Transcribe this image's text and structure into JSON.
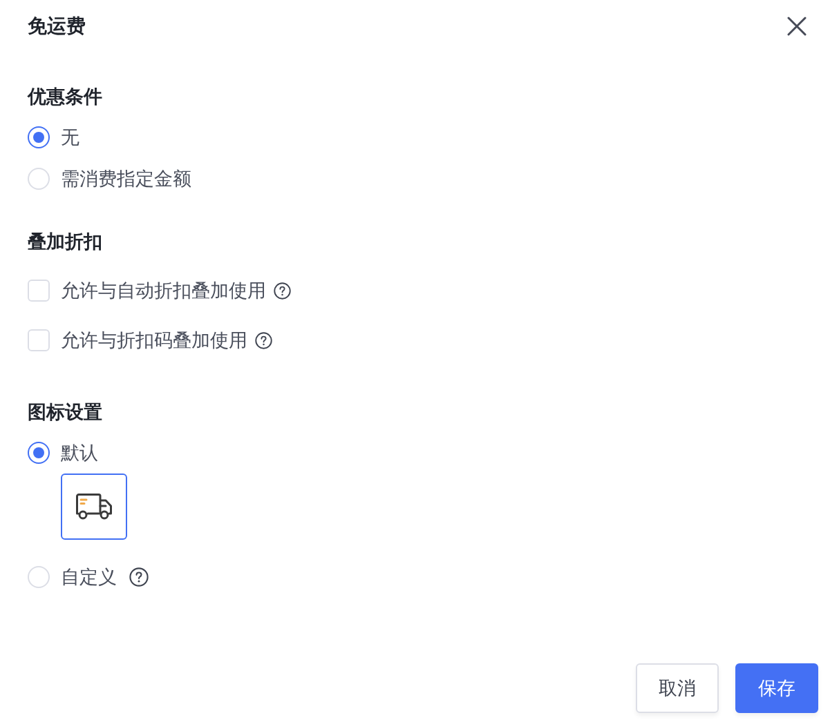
{
  "dialog": {
    "title": "免运费"
  },
  "sections": [
    {
      "kind": "radio",
      "heading": "优惠条件",
      "options": [
        {
          "label": "无",
          "selected": true
        },
        {
          "label": "需消费指定金额",
          "selected": false
        }
      ]
    },
    {
      "kind": "checkbox",
      "heading": "叠加折扣",
      "options": [
        {
          "label": "允许与自动折扣叠加使用",
          "checked": false,
          "help": true
        },
        {
          "label": "允许与折扣码叠加使用",
          "checked": false,
          "help": true
        }
      ]
    },
    {
      "kind": "icon_radio",
      "heading": "图标设置",
      "options": [
        {
          "label": "默认",
          "selected": true,
          "preview": {
            "selected": true
          }
        },
        {
          "label": "自定义",
          "selected": false,
          "help": true
        }
      ]
    }
  ],
  "buttons": [
    {
      "label": "取消",
      "kind": "secondary"
    },
    {
      "label": "保存",
      "kind": "primary"
    }
  ]
}
